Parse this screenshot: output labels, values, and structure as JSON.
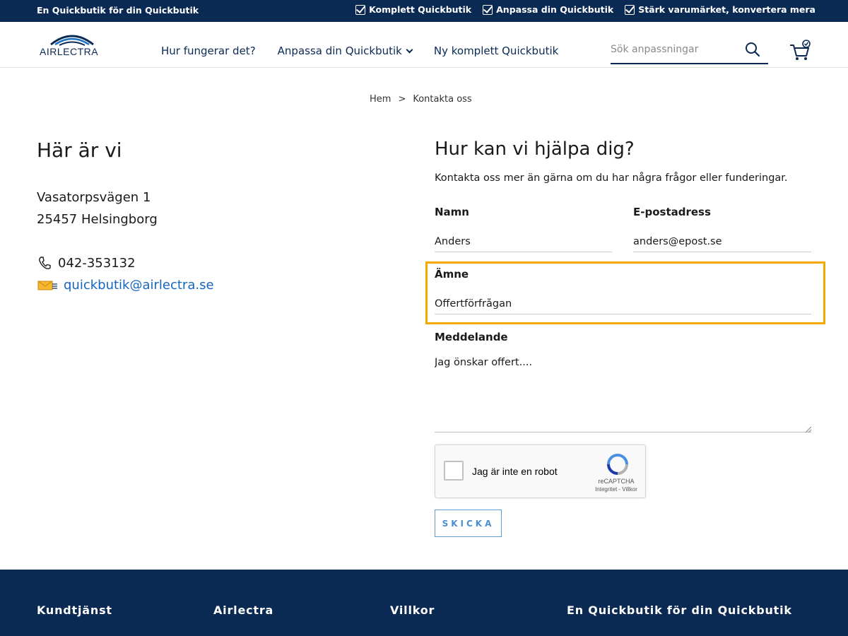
{
  "topbar": {
    "tagline": "En Quickbutik för din Quickbutik",
    "perks": [
      "Komplett Quickbutik",
      "Anpassa din Quickbutik",
      "Stärk varumärket, konvertera mera"
    ]
  },
  "header": {
    "logo_text": "AIRLECTRA",
    "nav": [
      "Hur fungerar det?",
      "Anpassa din Quickbutik",
      "Ny komplett Quickbutik"
    ],
    "search_placeholder": "Sök anpassningar"
  },
  "breadcrumb": {
    "home": "Hem",
    "separator": ">",
    "current": "Kontakta oss"
  },
  "left": {
    "title": "Här är vi",
    "address_line1": "Vasatorpsvägen 1",
    "address_line2": "25457 Helsingborg",
    "phone": "042-353132",
    "email": "quickbutik@airlectra.se"
  },
  "form": {
    "title": "Hur kan vi hjälpa dig?",
    "intro": "Kontakta oss mer än gärna om du har några frågor eller funderingar.",
    "name_label": "Namn",
    "name_value": "Anders",
    "email_label": "E-postadress",
    "email_value": "anders@epost.se",
    "subject_label": "Ämne",
    "subject_value": "Offertförfrågan",
    "message_label": "Meddelande",
    "message_value": "Jag önskar offert....",
    "submit_label": "SKICKA"
  },
  "recaptcha": {
    "label": "Jag är inte en robot",
    "brand": "reCAPTCHA",
    "terms": "Integritet - Villkor"
  },
  "footer": {
    "columns": [
      "Kundtjänst",
      "Airlectra",
      "Villkor",
      "En Quickbutik för din Quickbutik"
    ]
  },
  "colors": {
    "navy": "#0a2a54",
    "highlight": "#f5a800",
    "link": "#1565c0"
  }
}
